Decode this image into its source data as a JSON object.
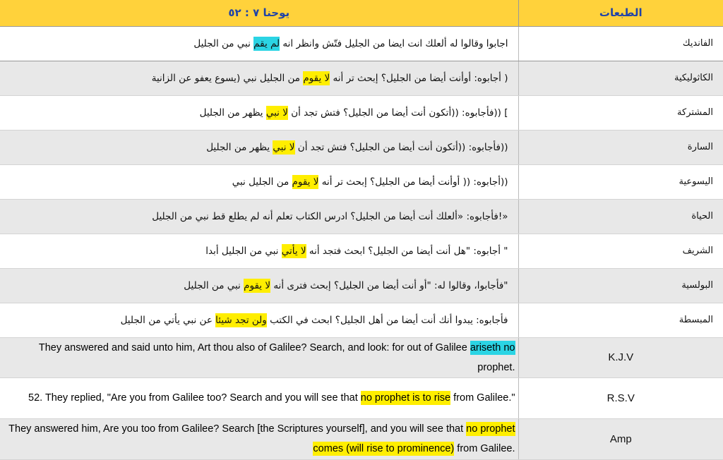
{
  "header": {
    "verse_title": "يوحنا ٧ : ٥٢",
    "editions_title": "الطبعات"
  },
  "rows": [
    {
      "edition": "الفانديك",
      "before": "اجابوا وقالوا له ألعلك انت ايضا من الجليل فتّش وانظر انه ",
      "hl": "لم يقم",
      "hl_color": "cyan",
      "after": " نبي من الجليل"
    },
    {
      "edition": "الكاثوليكية",
      "before": "( أجابوه:  أوأنت أيضا من الجليل؟ إبحث تر أنه ",
      "hl": "لا يقوم",
      "hl_color": "yellow",
      "after": " من الجليل نبي  (يسوع يعفو عن الزانية"
    },
    {
      "edition": "المشتركة",
      "before": "]  ((فأجابوه: ((أتكون أنت أيضا من الجليل؟ فتش تجد أن ",
      "hl": "لا نبي",
      "hl_color": "yellow",
      "after": " يظهر من الجليل"
    },
    {
      "edition": "السارة",
      "before": "((فأجابوه: ((أتكون أنت أيضا من الجليل؟ فتش تجد أن ",
      "hl": "لا نبي",
      "hl_color": "yellow",
      "after": " يظهر من الجليل"
    },
    {
      "edition": "اليسوعية",
      "before": "((أجابوه: (( أوأنت أيضا من الجليل؟ إبحث تر أنه ",
      "hl": "لا يقوم",
      "hl_color": "yellow",
      "after": " من الجليل نبي"
    },
    {
      "edition": "الحياة",
      "before": "«!فأجابوه: «ألعلك أنت أيضا من الجليل؟ ادرس الكتاب تعلم أنه لم يطلع قط نبي من الجليل",
      "hl": "",
      "hl_color": "yellow",
      "after": ""
    },
    {
      "edition": "الشريف",
      "before": "\" أجابوه: \"هل أنت أيضا من الجليل؟ ابحث فتجد أنه ",
      "hl": "لا يأتي",
      "hl_color": "yellow",
      "after": " نبي من الجليل أبدا"
    },
    {
      "edition": "البولسية",
      "before": "\"فأجابوا، وقالوا له: \"أو أنت أيضا من الجليل؟ إبحث فترى أنه ",
      "hl": "لا يقوم",
      "hl_color": "yellow",
      "after": " نبي من الجليل"
    },
    {
      "edition": "المبسطة",
      "before": "فأجابوه: يبدوا أنك أنت أيضا من أهل الجليل؟ ابحث في الكتب ",
      "hl": "ولن تجد شيئا",
      "hl_color": "yellow",
      "after": " عن نبي يأتي من الجليل"
    }
  ],
  "en_rows": [
    {
      "edition": "K.J.V",
      "before": "They answered and said unto him, Art thou also of Galilee? Search, and look: for out of Galilee ",
      "hl": "ariseth no",
      "hl_color": "cyan",
      "after": " prophet."
    },
    {
      "edition": "R.S.V",
      "before": "52. They replied, \"Are you from Galilee too? Search and you will see that ",
      "hl": "no prophet is to rise",
      "hl_color": "yellow",
      "after": " from Galilee.\""
    },
    {
      "edition": "Amp",
      "before": "They answered him, Are you too from Galilee? Search [the Scriptures yourself], and you will see that ",
      "hl": "no prophet comes (will rise to prominence)",
      "hl_color": "yellow",
      "after": " from Galilee."
    }
  ]
}
